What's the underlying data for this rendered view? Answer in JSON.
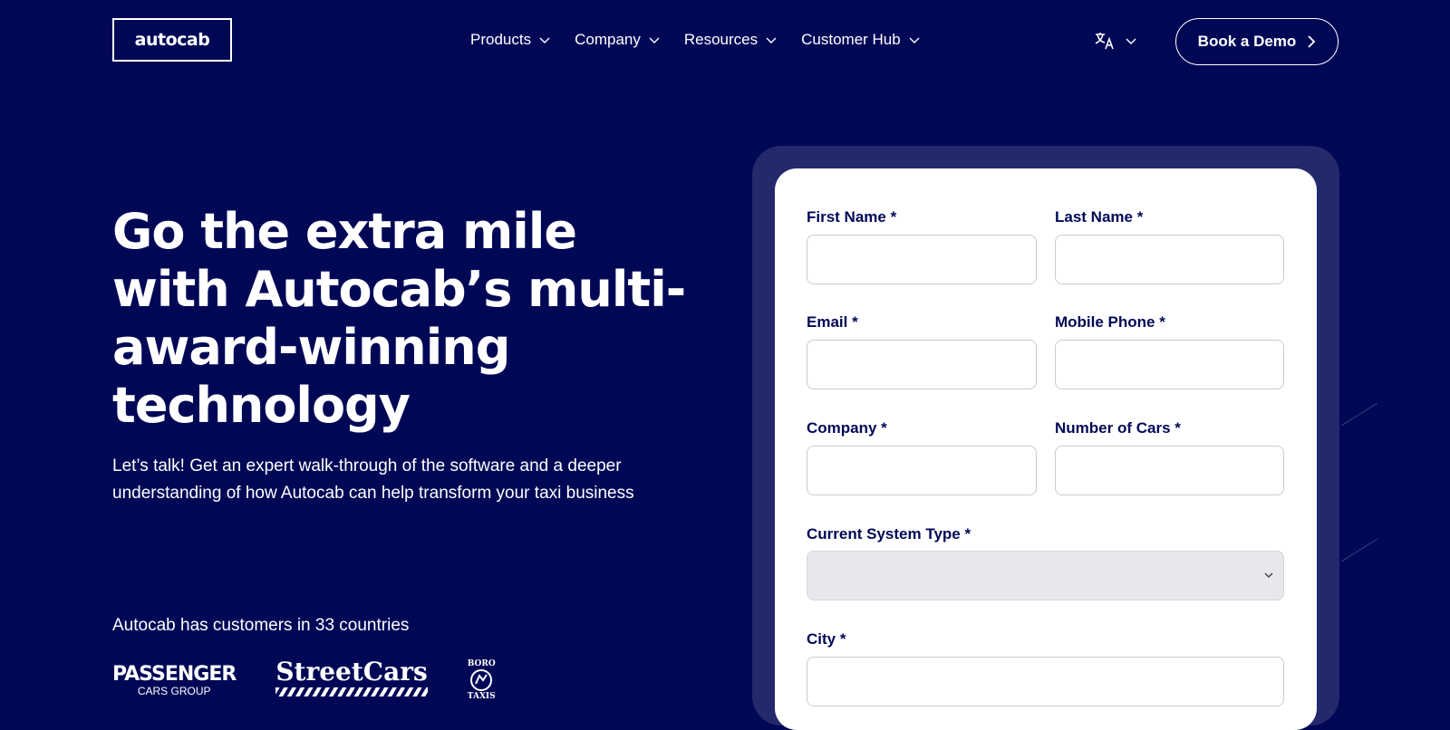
{
  "header": {
    "logo_text": "autocab",
    "nav": [
      {
        "label": "Products"
      },
      {
        "label": "Company"
      },
      {
        "label": "Resources"
      },
      {
        "label": "Customer Hub"
      }
    ],
    "book_demo_label": "Book a Demo"
  },
  "hero": {
    "title": "Go the extra mile with Autocab’s multi-award-winning technology",
    "subtitle": "Let’s talk! Get an expert walk-through of the software and a deeper understanding of how Autocab can help transform your taxi business",
    "customers_text": "Autocab has customers in 33 countries",
    "customer_logos": {
      "passenger_big": "PASSENGER",
      "passenger_small": "CARS GROUP",
      "streetcars": "StreetCars",
      "boro_top": "BORO",
      "boro_bottom": "TAXIS"
    }
  },
  "form": {
    "first_name_label": "First Name *",
    "first_name_value": "",
    "last_name_label": "Last Name *",
    "last_name_value": "",
    "email_label": "Email *",
    "email_value": "",
    "mobile_label": "Mobile Phone *",
    "mobile_value": "",
    "company_label": "Company *",
    "company_value": "",
    "cars_label": "Number of Cars *",
    "cars_value": "",
    "system_label": "Current System Type *",
    "system_value": "",
    "city_label": "City *",
    "city_value": ""
  },
  "colors": {
    "background": "#000856",
    "card_border": "#23296b",
    "label": "#000856"
  }
}
